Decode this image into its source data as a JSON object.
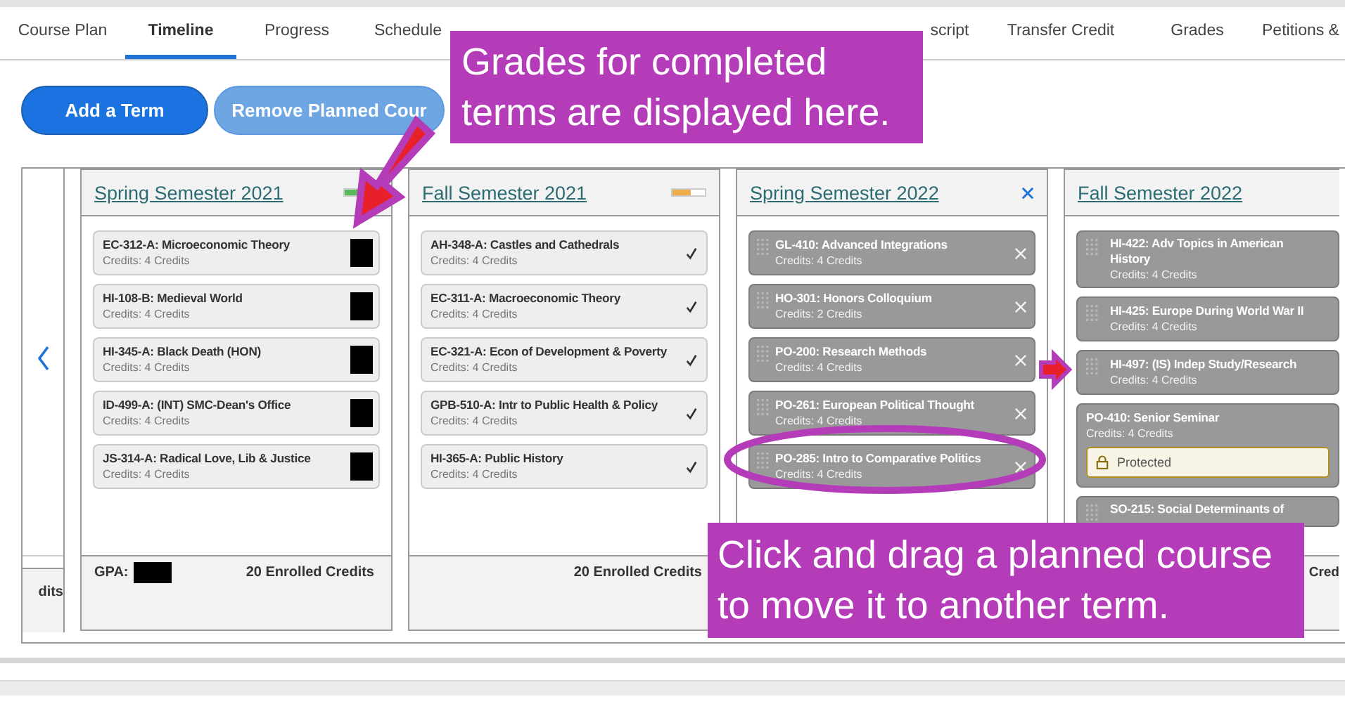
{
  "tabs": [
    {
      "label": "Course Plan",
      "selected": false
    },
    {
      "label": "Timeline",
      "selected": true
    },
    {
      "label": "Progress",
      "selected": false
    },
    {
      "label": "Schedule",
      "selected": false
    },
    {
      "label": "script",
      "selected": false
    },
    {
      "label": "Transfer Credit",
      "selected": false
    },
    {
      "label": "Grades",
      "selected": false
    },
    {
      "label": "Petitions &",
      "selected": false
    }
  ],
  "actions": [
    {
      "label": "Add a Term",
      "disabled": false
    },
    {
      "label": "Remove Planned Cour",
      "disabled": true
    }
  ],
  "partial_term": {
    "footer": "dits"
  },
  "terms": [
    {
      "title": "Spring Semester 2021",
      "status": {
        "level": 1,
        "color": "#5cb85c"
      },
      "courses": [
        {
          "kind": "graded",
          "title": "EC-312-A: Microeconomic Theory",
          "credits": "Credits: 4 Credits"
        },
        {
          "kind": "graded",
          "title": "HI-108-B: Medieval World",
          "credits": "Credits: 4 Credits"
        },
        {
          "kind": "graded",
          "title": "HI-345-A: Black Death (HON)",
          "credits": "Credits: 4 Credits"
        },
        {
          "kind": "graded",
          "title": "ID-499-A: (INT) SMC-Dean's Office",
          "credits": "Credits: 4 Credits"
        },
        {
          "kind": "graded",
          "title": "JS-314-A: Radical Love, Lib & Justice",
          "credits": "Credits: 4 Credits"
        }
      ],
      "gpa_label": "GPA:",
      "footer": "20 Enrolled Credits"
    },
    {
      "title": "Fall Semester 2021",
      "status": {
        "level": 0.55,
        "color": "#f0ad4e"
      },
      "courses": [
        {
          "kind": "completed",
          "title": "AH-348-A: Castles and Cathedrals",
          "credits": "Credits: 4 Credits"
        },
        {
          "kind": "completed",
          "title": "EC-311-A: Macroeconomic Theory",
          "credits": "Credits: 4 Credits"
        },
        {
          "kind": "completed",
          "title": "EC-321-A: Econ of Development & Poverty",
          "credits": "Credits: 4 Credits"
        },
        {
          "kind": "completed",
          "title": "GPB-510-A: Intr to Public Health & Policy",
          "credits": "Credits: 4 Credits"
        },
        {
          "kind": "completed",
          "title": "HI-365-A: Public History",
          "credits": "Credits: 4 Credits"
        }
      ],
      "footer": "20 Enrolled Credits"
    },
    {
      "title": "Spring Semester 2022",
      "closable": true,
      "courses": [
        {
          "kind": "planned",
          "title": "GL-410: Advanced Integrations",
          "credits": "Credits: 4 Credits"
        },
        {
          "kind": "planned",
          "title": "HO-301: Honors Colloquium",
          "credits": "Credits: 2 Credits"
        },
        {
          "kind": "planned",
          "title": "PO-200: Research Methods",
          "credits": "Credits: 4 Credits"
        },
        {
          "kind": "planned",
          "title": "PO-261: European Political Thought",
          "credits": "Credits: 4 Credits"
        },
        {
          "kind": "planned",
          "title": "PO-285: Intro to Comparative Politics",
          "credits": "Credits: 4 Credits"
        }
      ]
    },
    {
      "title": "Fall Semester 2022",
      "courses": [
        {
          "kind": "planned",
          "title": "HI-422: Adv Topics in American History",
          "credits": "Credits: 4 Credits"
        },
        {
          "kind": "planned",
          "title": "HI-425: Europe During World War II",
          "credits": "Credits: 4 Credits"
        },
        {
          "kind": "planned",
          "title": "HI-497: (IS) Indep Study/Research",
          "credits": "Credits: 4 Credits"
        },
        {
          "kind": "protected",
          "title": "PO-410: Senior Seminar",
          "credits": "Credits: 4 Credits",
          "badge": "Protected"
        },
        {
          "kind": "planned",
          "title": "SO-215: Social Determinants of"
        }
      ],
      "footer": "Cred"
    }
  ],
  "callouts": [
    "Grades for completed terms are displayed here.",
    "Click and drag a planned course to move it to another term."
  ]
}
